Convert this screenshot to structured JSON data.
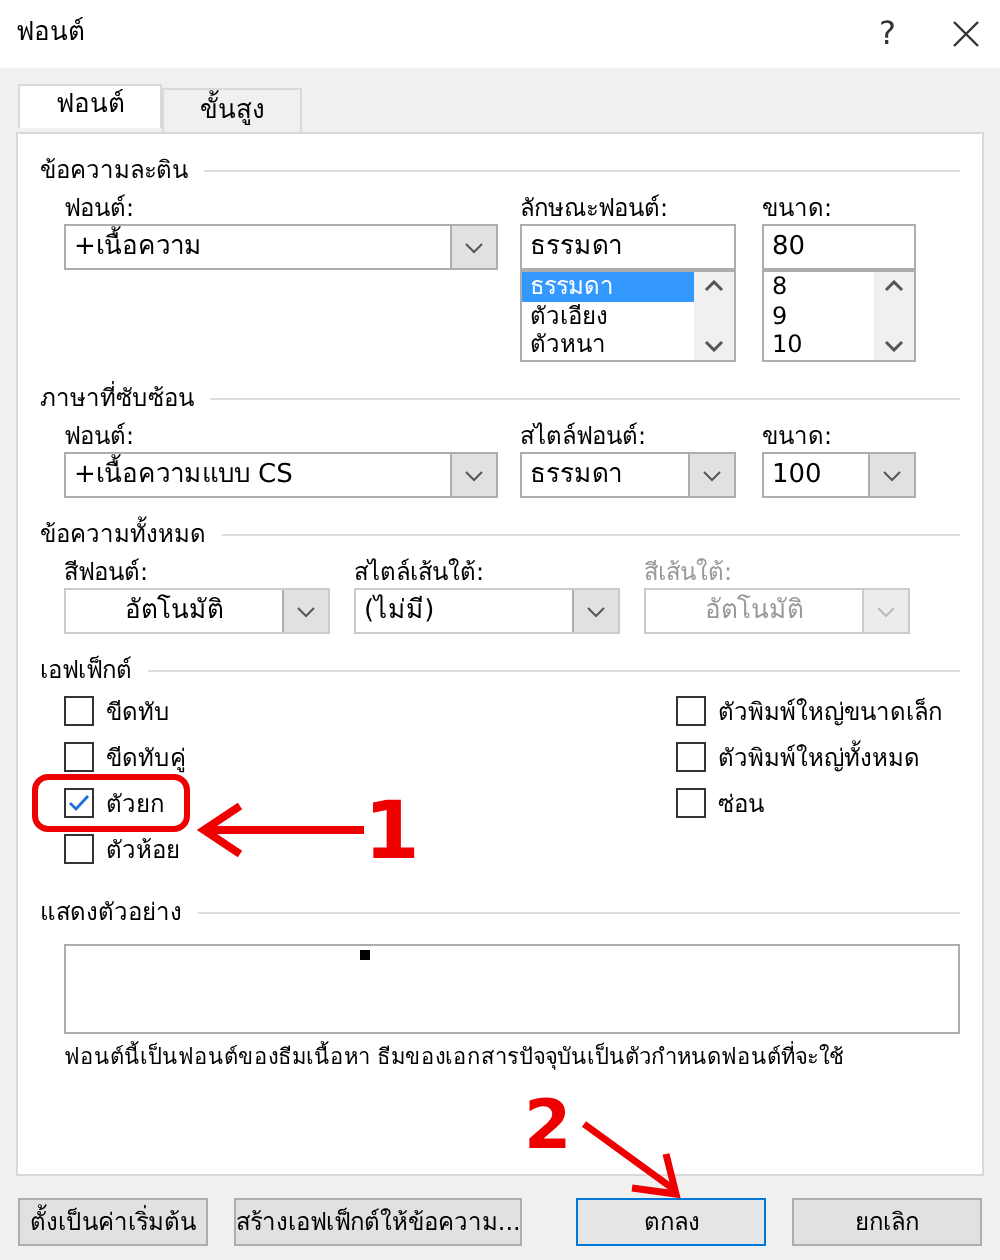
{
  "window": {
    "title": "ฟอนต์",
    "help": "?"
  },
  "tabs": [
    {
      "label": "ฟอนต์",
      "selected": true
    },
    {
      "label": "ขั้นสูง",
      "selected": false
    }
  ],
  "latin": {
    "heading": "ข้อความละติน",
    "font": {
      "label": "ฟอนต์:",
      "value": "+เนื้อความ"
    },
    "style": {
      "label": "ลักษณะฟอนต์:",
      "value": "ธรรมดา",
      "options": [
        {
          "label": "ธรรมดา",
          "selected": true
        },
        {
          "label": "ตัวเอียง",
          "selected": false
        },
        {
          "label": "ตัวหนา",
          "selected": false
        }
      ]
    },
    "size": {
      "label": "ขนาด:",
      "value": "80",
      "options": [
        {
          "label": "8",
          "selected": false
        },
        {
          "label": "9",
          "selected": false
        },
        {
          "label": "10",
          "selected": false
        }
      ]
    }
  },
  "complex": {
    "heading": "ภาษาที่ซับซ้อน",
    "font": {
      "label": "ฟอนต์:",
      "value": "+เนื้อความแบบ CS"
    },
    "style": {
      "label": "สไตล์ฟอนต์:",
      "value": "ธรรมดา"
    },
    "size": {
      "label": "ขนาด:",
      "value": "100"
    }
  },
  "all_text": {
    "heading": "ข้อความทั้งหมด",
    "fields": [
      {
        "label": "สีฟอนต์:",
        "value": "อัตโนมัติ",
        "kind": "color",
        "disabled": false
      },
      {
        "label": "สไตล์เส้นใต้:",
        "value": "(ไม่มี)",
        "kind": "list",
        "disabled": false
      },
      {
        "label": "สีเส้นใต้:",
        "value": "อัตโนมัติ",
        "kind": "color",
        "disabled": true
      }
    ]
  },
  "effects": {
    "heading": "เอฟเฟ็กต์",
    "left": [
      {
        "label": "ขีดทับ",
        "checked": false,
        "highlighted": false
      },
      {
        "label": "ขีดทับคู่",
        "checked": false,
        "highlighted": false
      },
      {
        "label": "ตัวยก",
        "checked": true,
        "highlighted": true
      },
      {
        "label": "ตัวห้อย",
        "checked": false,
        "highlighted": false
      }
    ],
    "right": [
      {
        "label": "ตัวพิมพ์ใหญ่ขนาดเล็ก",
        "checked": false
      },
      {
        "label": "ตัวพิมพ์ใหญ่ทั้งหมด",
        "checked": false
      },
      {
        "label": "ซ่อน",
        "checked": false
      }
    ]
  },
  "preview": {
    "heading": "แสดงตัวอย่าง",
    "note": "ฟอนต์นี้เป็นฟอนต์ของธีมเนื้อหา ธีมของเอกสารปัจจุบันเป็นตัวกำหนดฟอนต์ที่จะใช้"
  },
  "buttons": [
    {
      "label": "ตั้งเป็นค่าเริ่มต้น",
      "default": false
    },
    {
      "label": "สร้างเอฟเฟ็กต์ให้ข้อความ...",
      "default": false
    },
    {
      "label": "ตกลง",
      "default": true
    },
    {
      "label": "ยกเลิก",
      "default": false
    }
  ],
  "annotations": [
    {
      "label": "1"
    },
    {
      "label": "2"
    }
  ]
}
